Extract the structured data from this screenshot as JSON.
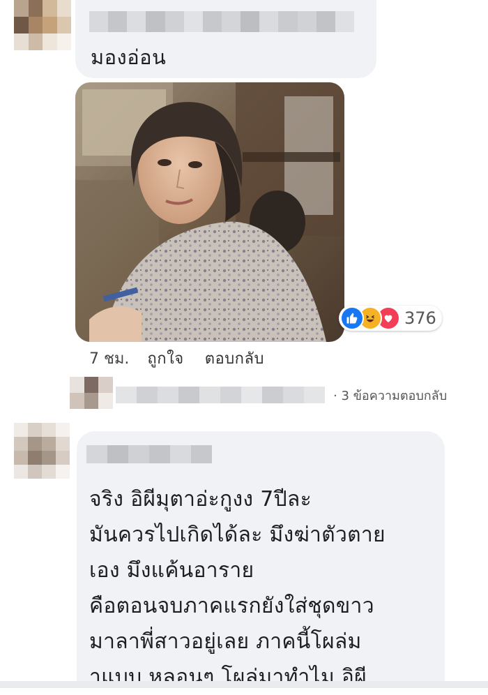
{
  "comment1": {
    "text": "มองอ่อน",
    "image_alt": "reaction photo of a woman glancing sideways",
    "reactions": {
      "icons": [
        "like-icon",
        "haha-icon",
        "love-icon"
      ],
      "colors": {
        "like": "#1877f2",
        "haha": "#f7b125",
        "love": "#f33e58"
      },
      "count": "376"
    },
    "meta": {
      "time": "7 ชม.",
      "like_label": "ถูกใจ",
      "reply_label": "ตอบกลับ"
    },
    "replies_label": "· 3 ข้อความตอบกลับ"
  },
  "comment2": {
    "lines": [
      "จริง อิผีมุตาอ่ะกูงง 7ปีละ",
      "มันควรไปเกิดได้ละ มึงฆ่าตัวตาย",
      "เอง มึงแค้นอาราย",
      "คือตอนจบภาคแรกยังใส่ชุดขาว",
      "มาลาพี่สาวอยู่เลย ภาคนี้โผล่ม",
      "าแบบ หลอนๆ โผล่มาทำไม อิผี"
    ]
  },
  "colors": {
    "bubble": "#f0f2f5",
    "text": "#1c1e21",
    "meta": "#444444"
  }
}
